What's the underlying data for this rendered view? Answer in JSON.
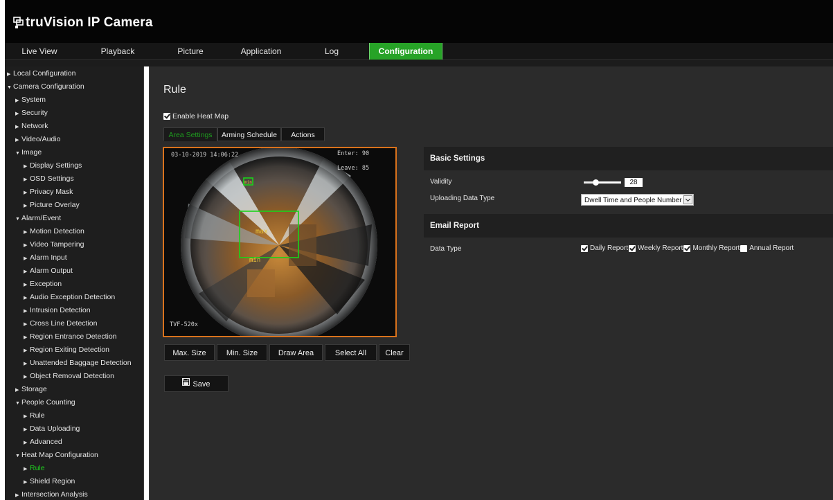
{
  "header": {
    "logo_text": "truVision IP Camera",
    "accent_color": "#27a327"
  },
  "nav": {
    "tabs": [
      {
        "label": "Live View"
      },
      {
        "label": "Playback"
      },
      {
        "label": "Picture"
      },
      {
        "label": "Application"
      },
      {
        "label": "Log"
      },
      {
        "label": "Configuration",
        "active": true
      }
    ]
  },
  "sidebar": {
    "items": [
      {
        "label": "Local Configuration",
        "expanded": false
      },
      {
        "label": "Camera Configuration",
        "expanded": true
      },
      {
        "label": "System",
        "expanded": false
      },
      {
        "label": "Security",
        "expanded": false
      },
      {
        "label": "Network",
        "expanded": false
      },
      {
        "label": "Video/Audio",
        "expanded": false
      },
      {
        "label": "Image",
        "expanded": true
      },
      {
        "label": "Display Settings"
      },
      {
        "label": "OSD Settings"
      },
      {
        "label": "Privacy Mask"
      },
      {
        "label": "Picture Overlay"
      },
      {
        "label": "Alarm/Event",
        "expanded": true
      },
      {
        "label": "Motion Detection"
      },
      {
        "label": "Video Tampering"
      },
      {
        "label": "Alarm Input"
      },
      {
        "label": "Alarm Output"
      },
      {
        "label": "Exception"
      },
      {
        "label": "Audio Exception Detection"
      },
      {
        "label": "Intrusion Detection"
      },
      {
        "label": "Cross Line Detection"
      },
      {
        "label": "Region Entrance Detection"
      },
      {
        "label": "Region Exiting Detection"
      },
      {
        "label": "Unattended Baggage Detection"
      },
      {
        "label": "Object Removal Detection"
      },
      {
        "label": "Storage",
        "expanded": false
      },
      {
        "label": "People Counting",
        "expanded": true
      },
      {
        "label": "Rule"
      },
      {
        "label": "Data Uploading"
      },
      {
        "label": "Advanced"
      },
      {
        "label": "Heat Map Configuration",
        "expanded": true
      },
      {
        "label": "Rule",
        "active": true
      },
      {
        "label": "Shield Region"
      },
      {
        "label": "Intersection Analysis",
        "expanded": false
      }
    ]
  },
  "main": {
    "title": "Rule",
    "enable_heat_map": {
      "label": "Enable Heat Map",
      "checked": true
    },
    "tabs": [
      {
        "label": "Area Settings",
        "active": true
      },
      {
        "label": "Arming Schedule"
      },
      {
        "label": "Actions"
      }
    ],
    "video": {
      "timestamp": "03-10-2019 14:06:22",
      "enter_text": "Enter: 90",
      "leave_text": "Leave: 85",
      "camera_label": "TVF-520x",
      "max_box_label": "max",
      "min_box_label": "min",
      "border_color": "#d9721c",
      "box_color": "#19d419"
    },
    "buttons": [
      {
        "label": "Max. Size"
      },
      {
        "label": "Min. Size"
      },
      {
        "label": "Draw Area"
      },
      {
        "label": "Select All"
      },
      {
        "label": "Clear"
      }
    ],
    "save_label": "Save",
    "save_icon": "floppy-disk-icon"
  },
  "settings": {
    "basic_header": "Basic Settings",
    "validity_label": "Validity",
    "validity_value": "28",
    "uploading_label": "Uploading Data Type",
    "uploading_value": "Dwell Time and People Number",
    "email_header": "Email Report",
    "data_type_label": "Data Type",
    "data_type_options": [
      {
        "label": "Daily Report",
        "checked": true
      },
      {
        "label": "Weekly Report",
        "checked": true
      },
      {
        "label": "Monthly Report",
        "checked": true
      },
      {
        "label": "Annual Report",
        "checked": false
      }
    ]
  }
}
